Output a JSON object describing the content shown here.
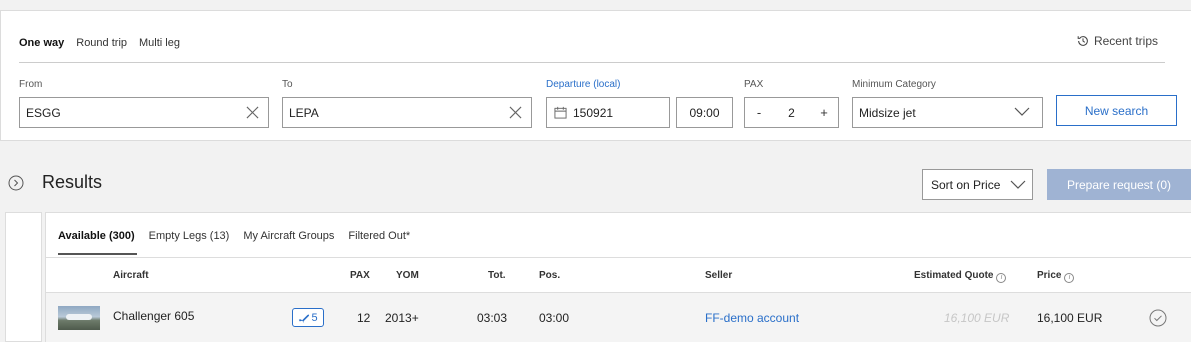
{
  "trip_tabs": [
    "One way",
    "Round trip",
    "Multi leg"
  ],
  "recent_trips": "Recent trips",
  "fields": {
    "from_label": "From",
    "from_value": "ESGG",
    "to_label": "To",
    "to_value": "LEPA",
    "departure_label": "Departure (local)",
    "date_value": "150921",
    "time_value": "09:00",
    "pax_label": "PAX",
    "pax_minus": "-",
    "pax_value": "2",
    "pax_plus": "+",
    "category_label": "Minimum Category",
    "category_value": "Midsize jet"
  },
  "new_search": "New search",
  "results": {
    "title": "Results",
    "sort_label": "Sort on Price",
    "prepare_label": "Prepare request (0)",
    "tabs": [
      "Available (300)",
      "Empty Legs (13)",
      "My Aircraft Groups",
      "Filtered Out*"
    ],
    "columns": {
      "aircraft": "Aircraft",
      "pax": "PAX",
      "yom": "YOM",
      "tot": "Tot.",
      "pos": "Pos.",
      "seller": "Seller",
      "estimated_quote": "Estimated Quote",
      "price": "Price"
    },
    "rows": [
      {
        "aircraft": "Challenger 605",
        "badge_count": "5",
        "pax": "12",
        "yom": "2013+",
        "tot": "03:03",
        "pos": "03:00",
        "seller": "FF-demo account",
        "estimated_quote": "16,100 EUR",
        "price": "16,100 EUR"
      }
    ]
  },
  "colors": {
    "accent": "#2a6fc9",
    "disabled_button": "#9fb3d3"
  },
  "icons": [
    "history-icon",
    "clear-icon",
    "calendar-icon",
    "chevron-down-icon",
    "collapse-icon",
    "flight-icon",
    "info-icon",
    "check-circle-icon"
  ]
}
